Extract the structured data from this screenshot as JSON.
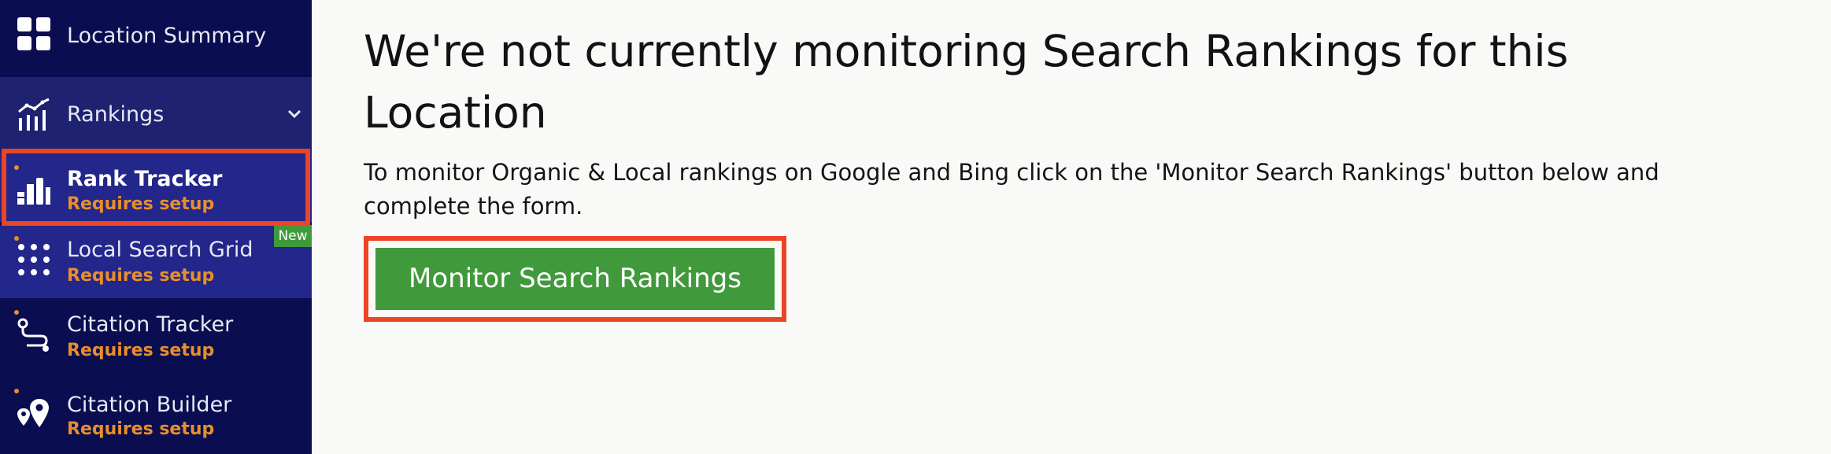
{
  "sidebar": {
    "location_summary": {
      "label": "Location Summary",
      "icon": "grid-icon"
    },
    "rankings": {
      "label": "Rankings",
      "icon": "chart-line-icon",
      "expanded": true
    },
    "rank_tracker": {
      "label": "Rank Tracker",
      "status": "Requires setup",
      "icon": "bar-chart-icon",
      "selected": true
    },
    "local_search_grid": {
      "label": "Local Search Grid",
      "status": "Requires setup",
      "badge": "New",
      "icon": "dots-grid-icon"
    },
    "citation_tracker": {
      "label": "Citation Tracker",
      "status": "Requires setup",
      "icon": "route-icon"
    },
    "citation_builder": {
      "label": "Citation Builder",
      "status": "Requires setup",
      "icon": "map-pins-icon"
    }
  },
  "main": {
    "headline": "We're not currently monitoring Search Rankings for this Location",
    "description": "To monitor Organic & Local rankings on Google and Bing click on the 'Monitor Search Rankings' button below and complete the form.",
    "cta_label": "Monitor Search Rankings"
  },
  "colors": {
    "sidebar_bg": "#0a0d50",
    "sidebar_active": "#23268a",
    "status_orange": "#e78f2c",
    "highlight_red": "#ea4525",
    "cta_green": "#40993b"
  }
}
